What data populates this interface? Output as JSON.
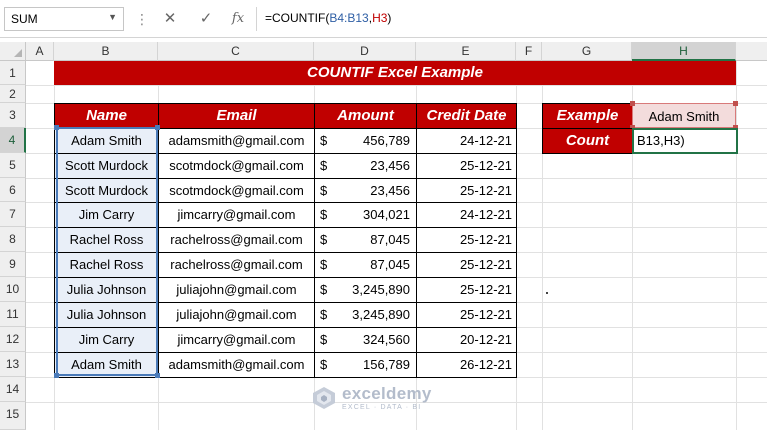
{
  "formula_bar": {
    "name_box": "SUM",
    "cancel_icon": "x-icon",
    "enter_icon": "checkmark-icon",
    "function_icon": "fx-icon",
    "formula_prefix": "=COUNTIF(",
    "formula_ref1": "B4:B13",
    "formula_sep": ",",
    "formula_ref2": "H3",
    "formula_suffix": ")"
  },
  "columns": [
    "A",
    "B",
    "C",
    "D",
    "E",
    "F",
    "G",
    "H"
  ],
  "rows": [
    "1",
    "2",
    "3",
    "4",
    "5",
    "6",
    "7",
    "8",
    "9",
    "10",
    "11",
    "12",
    "13",
    "14",
    "15"
  ],
  "title": "COUNTIF Excel Example",
  "table": {
    "headers": [
      "Name",
      "Email",
      "Amount",
      "Credit Date"
    ],
    "currency": "$",
    "rows": [
      {
        "name": "Adam Smith",
        "email": "adamsmith@gmail.com",
        "amount": "456,789",
        "date": "24-12-21"
      },
      {
        "name": "Scott Murdock",
        "email": "scotmdock@gmail.com",
        "amount": "23,456",
        "date": "25-12-21"
      },
      {
        "name": "Scott Murdock",
        "email": "scotmdock@gmail.com",
        "amount": "23,456",
        "date": "25-12-21"
      },
      {
        "name": "Jim Carry",
        "email": "jimcarry@gmail.com",
        "amount": "304,021",
        "date": "24-12-21"
      },
      {
        "name": "Rachel Ross",
        "email": "rachelross@gmail.com",
        "amount": "87,045",
        "date": "25-12-21"
      },
      {
        "name": "Rachel Ross",
        "email": "rachelross@gmail.com",
        "amount": "87,045",
        "date": "25-12-21"
      },
      {
        "name": "Julia Johnson",
        "email": "juliajohn@gmail.com",
        "amount": "3,245,890",
        "date": "25-12-21"
      },
      {
        "name": "Julia Johnson",
        "email": "juliajohn@gmail.com",
        "amount": "3,245,890",
        "date": "25-12-21"
      },
      {
        "name": "Jim Carry",
        "email": "jimcarry@gmail.com",
        "amount": "324,560",
        "date": "20-12-21"
      },
      {
        "name": "Adam Smith",
        "email": "adamsmith@gmail.com",
        "amount": "156,789",
        "date": "26-12-21"
      }
    ]
  },
  "side": {
    "example_label": "Example",
    "example_value": "Adam Smith",
    "count_label": "Count",
    "count_edit": "B13,H3)"
  },
  "watermark": {
    "brand": "exceldemy",
    "tagline": "EXCEL · DATA · BI"
  },
  "colors": {
    "header_red": "#c00000",
    "selection_blue": "#4a7ab8",
    "active_green": "#217346",
    "name_fill": "#e9eff8"
  }
}
